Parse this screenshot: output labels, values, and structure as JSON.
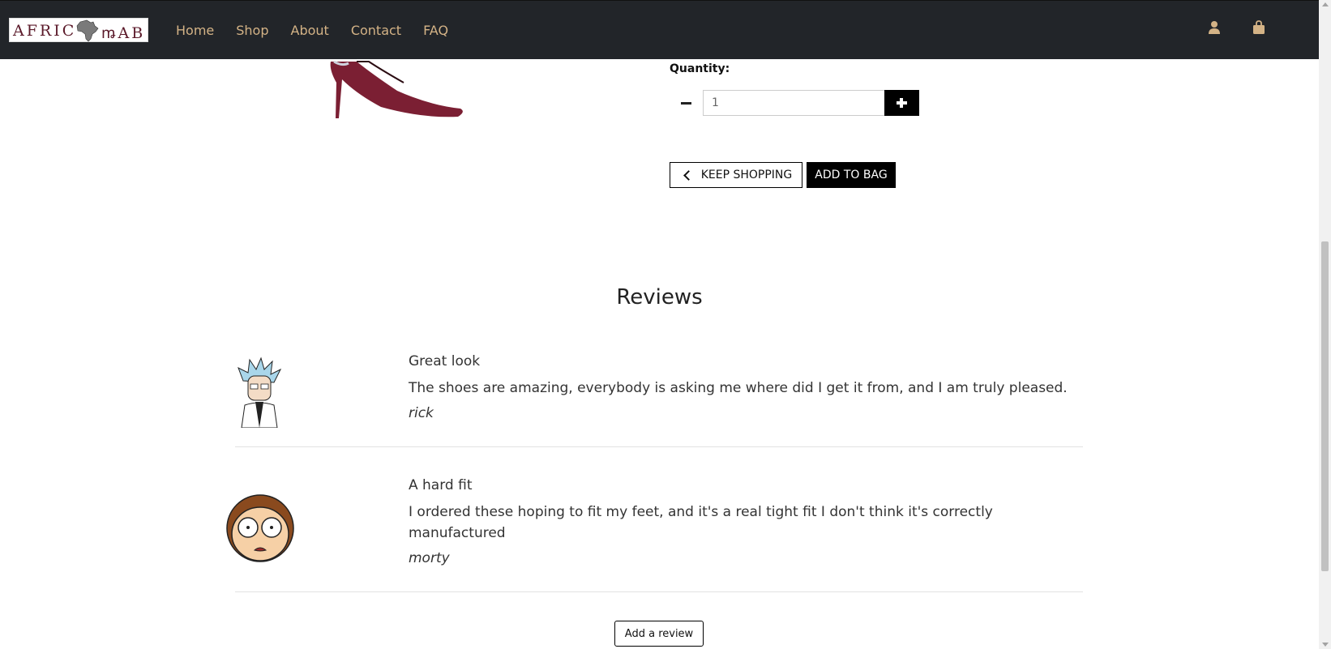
{
  "brand": {
    "logo_text_left": "AFRIC",
    "logo_text_right": "ꬺAB"
  },
  "nav": {
    "links": [
      {
        "label": "Home"
      },
      {
        "label": "Shop"
      },
      {
        "label": "About"
      },
      {
        "label": "Contact"
      },
      {
        "label": "FAQ"
      }
    ],
    "icons": [
      "user-icon",
      "shopping-bag-icon"
    ]
  },
  "product": {
    "quantity_label": "Quantity:",
    "quantity_value": "1",
    "keep_shopping_label": "KEEP SHOPPING",
    "add_to_bag_label": "ADD TO BAG"
  },
  "reviews": {
    "heading": "Reviews",
    "items": [
      {
        "title": "Great look",
        "body": "The shoes are amazing, everybody is asking me where did I get it from, and I am truly pleased.",
        "author": "rick"
      },
      {
        "title": "A hard fit",
        "body": "I ordered these hoping to fit my feet, and it's a real tight fit I don't think it's correctly manufactured",
        "author": "morty"
      }
    ],
    "add_review_label": "Add a review"
  },
  "colors": {
    "navbar_bg": "#222529",
    "nav_link": "#d4b386",
    "brand_text": "#5b1a2a",
    "shoe": "#7b1f33"
  }
}
